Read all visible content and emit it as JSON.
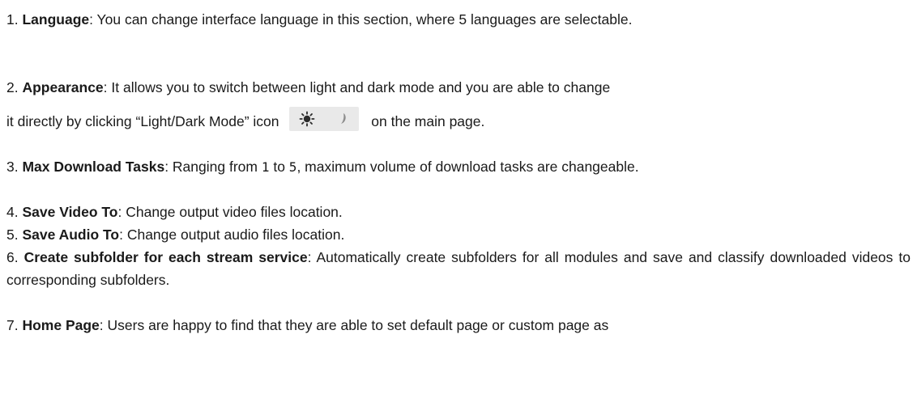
{
  "items": [
    {
      "number": "1.",
      "title": "Language",
      "text": ": You can change interface language in this section, where 5 languages are selectable."
    },
    {
      "number": "2.",
      "title": "Appearance",
      "text_part1": ": It allows you to switch between light and dark mode and you are able to change",
      "text_part2_before": "it directly by clicking “Light/Dark Mode” icon",
      "text_part2_after": "on the main page.",
      "icons": [
        "sun-icon",
        "moon-icon"
      ]
    },
    {
      "number": "3.",
      "title": "Max Download Tasks",
      "text_a": ": Ranging from ",
      "num_a": "1",
      "text_b": " to ",
      "num_b": "5",
      "text_c": ", maximum volume of download tasks are changeable."
    },
    {
      "number": "4.",
      "title": "Save Video To",
      "text": ": Change output video files location."
    },
    {
      "number": "5.",
      "title": "Save Audio To",
      "text": ": Change output audio files location."
    },
    {
      "number": "6.",
      "title": "Create subfolder for each stream service",
      "text": ": Automatically create subfolders for all modules and save and classify downloaded videos to corresponding subfolders."
    },
    {
      "number": "7.",
      "title": "Home Page",
      "text": ": Users are happy to find that they are able to set default page or custom page as"
    }
  ]
}
